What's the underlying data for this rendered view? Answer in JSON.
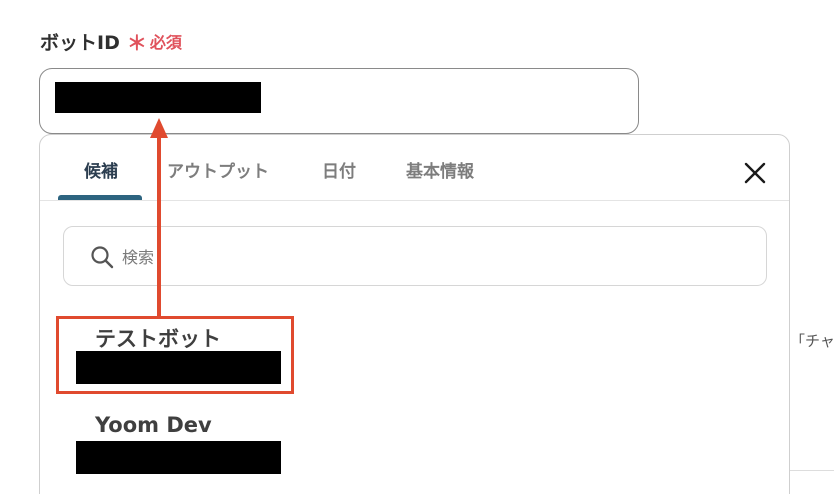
{
  "field": {
    "label": "ボットID",
    "required_mark": "＊",
    "required_text": "必須"
  },
  "dropdown": {
    "tabs": [
      {
        "label": "候補",
        "active": true
      },
      {
        "label": "アウトプット",
        "active": false
      },
      {
        "label": "日付",
        "active": false
      },
      {
        "label": "基本情報",
        "active": false
      }
    ],
    "search": {
      "placeholder": "検索",
      "value": ""
    },
    "items": [
      {
        "title": "テストボット",
        "highlighted": true
      },
      {
        "title": "Yoom Dev",
        "highlighted": false
      }
    ]
  },
  "side": {
    "text": "「チャ"
  },
  "colors": {
    "required": "#e0525c",
    "tab_indicator": "#2d6480",
    "annotation": "#e04a2f"
  },
  "icons": {
    "close": "close-icon",
    "search": "search-icon"
  }
}
